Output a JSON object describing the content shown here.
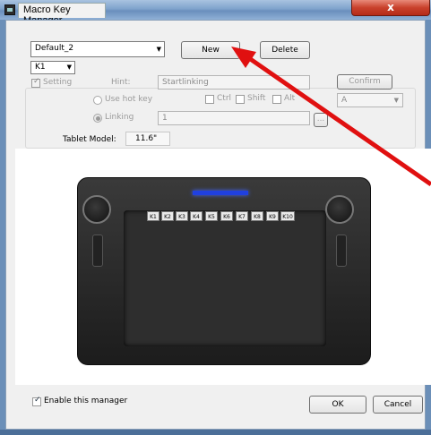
{
  "window": {
    "title": "Macro Key Manager",
    "close_glyph": "x"
  },
  "profile": {
    "selected": "Default_2",
    "new_label": "New",
    "delete_label": "Delete"
  },
  "key_select": {
    "selected": "K1"
  },
  "setting": {
    "label": "Setting",
    "checked": true,
    "hint_label": "Hint:",
    "hint_value": "Startlinking",
    "confirm_label": "Confirm",
    "use_hot_key_label": "Use hot key",
    "ctrl_label": "Ctrl",
    "shift_label": "Shift",
    "alt_label": "Alt",
    "key_value": "A",
    "linking_label": "Linking",
    "linking_value": "1",
    "browse_label": "..."
  },
  "tablet": {
    "model_label": "Tablet Model:",
    "model_value": "11.6\"",
    "hotkeys": [
      "K1",
      "K2",
      "K3",
      "K4",
      "K5",
      "K6",
      "K7",
      "K8",
      "K9",
      "K10"
    ]
  },
  "footer": {
    "enable_label": "Enable this manager",
    "enable_checked": true,
    "ok_label": "OK",
    "cancel_label": "Cancel"
  },
  "colors": {
    "accent_arrow": "#e01010",
    "led": "#2040e0",
    "titlebar": "#7fa3cc"
  }
}
